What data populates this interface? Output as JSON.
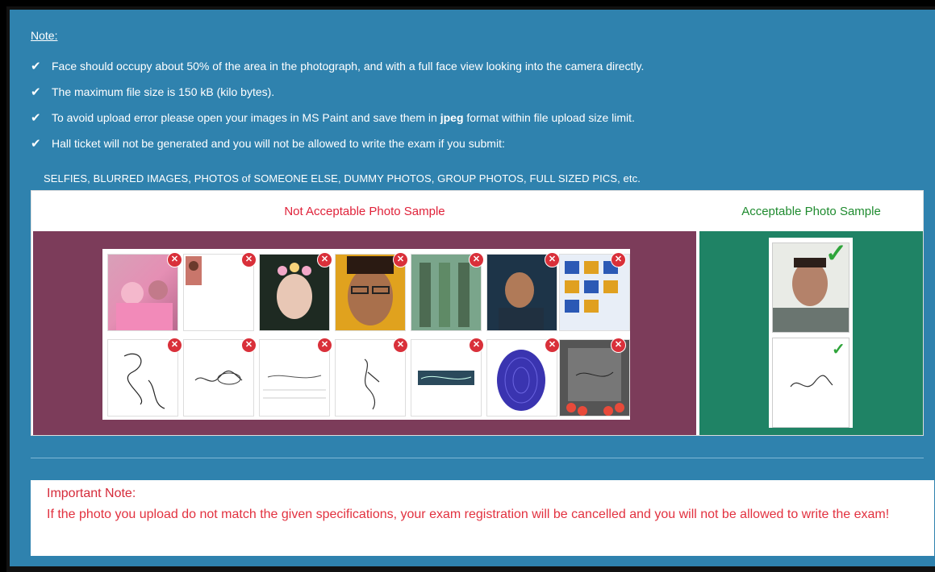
{
  "note": {
    "title": "Note:",
    "items": [
      "Face should occupy about 50% of the area in the photograph, and with a full face view looking into the camera directly.",
      "The maximum file size is 150 kB (kilo bytes).",
      "To avoid upload error please open your images in MS Paint and save them in ",
      "Hall ticket will not be generated and you will not be allowed to write the exam if you submit:"
    ],
    "jpeg_bold": "jpeg",
    "jpeg_tail": " format within file upload size limit.",
    "extra": "SELFIES, BLURRED IMAGES, PHOTOS of SOMEONE ELSE, DUMMY PHOTOS, GROUP PHOTOS, FULL SIZED PICS, etc."
  },
  "samples": {
    "not_acceptable_label": "Not Acceptable Photo Sample",
    "acceptable_label": "Acceptable Photo Sample"
  },
  "important": {
    "title": "Important Note:",
    "text": "If the photo you upload do not match the given specifications, your exam registration will be cancelled and you will not be allowed to write the exam!"
  },
  "colors": {
    "background": "#2f82ae",
    "bad_panel": "#7c3c5a",
    "good_panel": "#1f8365",
    "not_acceptable_text": "#e0223a",
    "acceptable_text": "#1f8b2f"
  }
}
